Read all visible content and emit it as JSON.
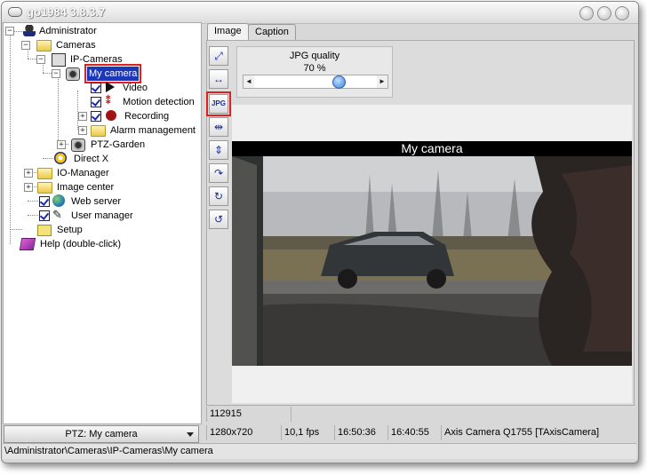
{
  "window": {
    "title": "go1984 3.8.3.7"
  },
  "tree": {
    "administrator": "Administrator",
    "cameras": "Cameras",
    "ip_cameras": "IP-Cameras",
    "my_camera": "My camera",
    "video": "Video",
    "motion_detection": "Motion detection",
    "recording": "Recording",
    "alarm_management": "Alarm management",
    "ptz_garden": "PTZ-Garden",
    "direct_x": "Direct X",
    "io_manager": "IO-Manager",
    "image_center": "Image center",
    "web_server": "Web server",
    "user_manager": "User manager",
    "setup": "Setup",
    "help": "Help (double-click)"
  },
  "ptz": {
    "selected": "PTZ: My camera"
  },
  "path": "\\Administrator\\Cameras\\IP-Cameras\\My camera",
  "tabs": [
    {
      "label": "Image"
    },
    {
      "label": "Caption"
    }
  ],
  "jpg": {
    "label": "JPG quality",
    "value": "70 %",
    "level": 0.7
  },
  "camera": {
    "title": "My camera"
  },
  "status": {
    "frame_count": "112915",
    "resolution": "1280x720",
    "fps": "10,1 fps",
    "time1": "16:50:36",
    "time2": "16:40:55",
    "device": "Axis Camera Q1755 [TAxisCamera]"
  },
  "icons": {
    "toolbar": [
      "fit-icon",
      "stretch-icon",
      "jpg-icon",
      "narrow-icon",
      "compress-icon",
      "rotate-icon",
      "rotate-cw-icon",
      "rotate-ccw-icon"
    ]
  },
  "colors": {
    "selection": "#1c37b8",
    "highlight": "#e02020"
  }
}
